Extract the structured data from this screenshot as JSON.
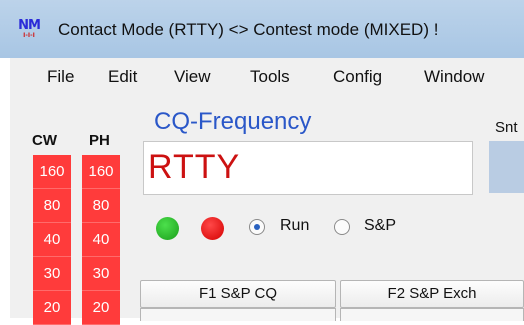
{
  "window": {
    "icon_text": "NM",
    "icon_sub": "I-I-I",
    "title": "Contact Mode (RTTY) <> Contest mode (MIXED) !"
  },
  "menu": [
    "File",
    "Edit",
    "View",
    "Tools",
    "Config",
    "Window"
  ],
  "bands": {
    "cw_header": "CW",
    "ph_header": "PH",
    "cw": [
      "160",
      "80",
      "40",
      "30",
      "20"
    ],
    "ph": [
      "160",
      "80",
      "40",
      "30",
      "20"
    ]
  },
  "cq": {
    "label": "CQ-Frequency",
    "value": "RTTY",
    "snt_label": "Snt"
  },
  "mode_radio": {
    "run_label": "Run",
    "sp_label": "S&P",
    "selected": "Run"
  },
  "function_keys": [
    "F1 S&P CQ",
    "F2 S&P Exch"
  ],
  "colors": {
    "band_active": "#ff3b3b",
    "freq_text": "#cc1111",
    "cq_label": "#2a57c8",
    "status_ok": "#1a9e1a",
    "status_err": "#d40000"
  }
}
